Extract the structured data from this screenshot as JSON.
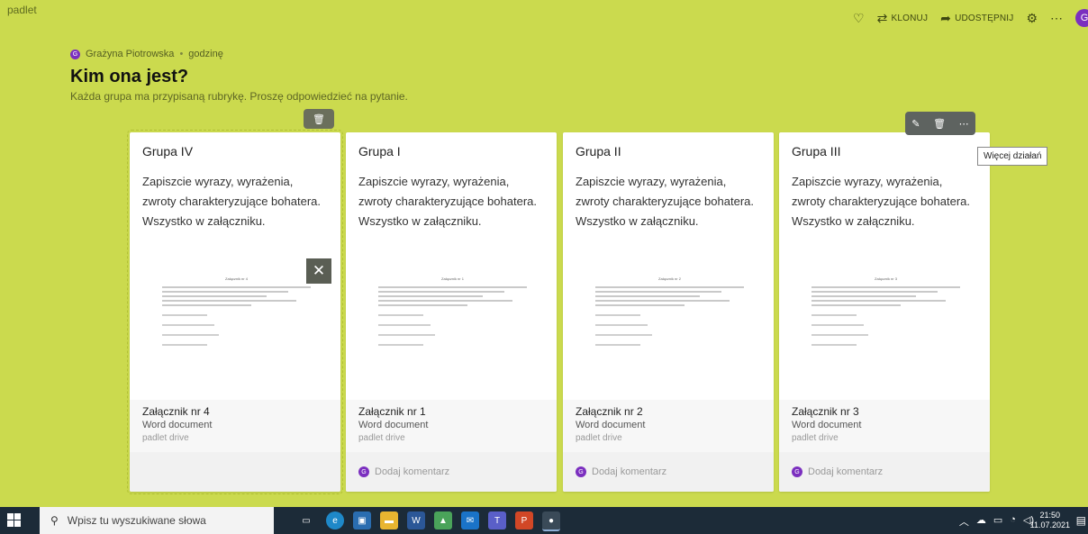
{
  "brand": "padlet",
  "topbar": {
    "clone_label": "KLONUJ",
    "share_label": "UDOSTĘPNIJ",
    "avatar_letter": "G"
  },
  "post": {
    "author": "Grażyna Piotrowska",
    "separator": "•",
    "time": "godzinę",
    "author_initial": "G",
    "title": "Kim ona jest?",
    "subtitle": "Każda grupa ma przypisaną rubrykę. Proszę odpowiedzieć na pytanie."
  },
  "cards": [
    {
      "title": "Grupa IV",
      "body": "Zapiszcie wyrazy, wyrażenia, zwroty charakteryzujące bohatera. Wszystko w załączniku.",
      "attachment_name": "Załącznik nr 4",
      "attachment_type": "Word document",
      "attachment_source": "padlet drive",
      "comment": ""
    },
    {
      "title": "Grupa I",
      "body": "Zapiszcie wyrazy, wyrażenia, zwroty charakteryzujące bohatera. Wszystko w załączniku.",
      "attachment_name": "Załącznik nr 1",
      "attachment_type": "Word document",
      "attachment_source": "padlet drive",
      "comment": "Dodaj komentarz"
    },
    {
      "title": "Grupa II",
      "body": "Zapiszcie wyrazy, wyrażenia, zwroty charakteryzujące bohatera. Wszystko w załączniku.",
      "attachment_name": "Załącznik nr 2",
      "attachment_type": "Word document",
      "attachment_source": "padlet drive",
      "comment": "Dodaj komentarz"
    },
    {
      "title": "Grupa III",
      "body": "Zapiszcie wyrazy, wyrażenia, zwroty charakteryzujące bohatera. Wszystko w załączniku.",
      "attachment_name": "Załącznik nr 3",
      "attachment_type": "Word document",
      "attachment_source": "padlet drive",
      "comment": "Dodaj komentarz"
    }
  ],
  "tooltip": "Więcej działań",
  "taskbar": {
    "search_placeholder": "Wpisz tu wyszukiwane słowa",
    "time": "21:50",
    "date": "11.07.2021"
  },
  "colors": {
    "background": "#cbda4e",
    "accent_avatar": "#7b2fbf",
    "taskbar": "#1c2b38"
  }
}
